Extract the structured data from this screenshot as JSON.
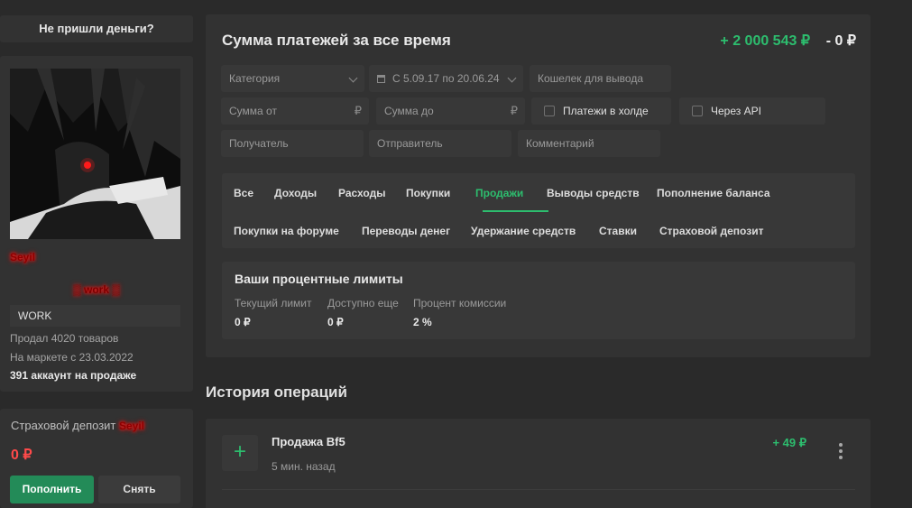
{
  "sidebar": {
    "no_money_label": "Не пришли деньги?",
    "profile": {
      "username": "Seyil",
      "title_badge": "▒ work ▒",
      "status_badge": "WORK",
      "sold": "Продал 4020 товаров",
      "on_market": "На маркете с 23.03.2022",
      "accounts_for_sale": "391 аккаунт на продаже"
    },
    "deposit": {
      "label": "Страховой депозит",
      "nick": "Seyil",
      "amount": "0 ₽",
      "topup_button": "Пополнить",
      "withdraw_button": "Снять"
    }
  },
  "payments": {
    "title": "Сумма платежей за все время",
    "income_total": "+ 2 000 543 ₽",
    "outcome_total": "- 0 ₽",
    "filters": {
      "category_placeholder": "Категория",
      "date_range": "С 5.09.17 по 20.06.24",
      "wallet_placeholder": "Кошелек для вывода",
      "sum_from_placeholder": "Сумма от",
      "sum_to_placeholder": "Сумма до",
      "currency_symbol": "₽",
      "hold_checkbox": "Платежи в холде",
      "api_checkbox": "Через API",
      "recipient_placeholder": "Получатель",
      "sender_placeholder": "Отправитель",
      "comment_placeholder": "Комментарий"
    },
    "tabs": [
      "Все",
      "Доходы",
      "Расходы",
      "Покупки",
      "Продажи",
      "Выводы средств",
      "Пополнение баланса",
      "Покупки на форуме",
      "Переводы денег",
      "Удержание средств",
      "Ставки",
      "Страховой депозит"
    ],
    "active_tab": "Продажи",
    "limits": {
      "title": "Ваши процентные лимиты",
      "current_label": "Текущий лимит",
      "current_value": "0 ₽",
      "available_label": "Доступно еще",
      "available_value": "0 ₽",
      "commission_label": "Процент комиссии",
      "commission_value": "2 %"
    }
  },
  "history": {
    "title": "История операций",
    "operations": [
      {
        "icon": "plus-icon",
        "title": "Продажа Bf5",
        "time": "5 мин. назад",
        "amount": "+ 49 ₽"
      }
    ]
  },
  "colors": {
    "accent_green": "#2dbd6e",
    "button_green": "#238b58",
    "negative_red": "#ff4a4a",
    "nick_glow_red": "#ff2020"
  }
}
